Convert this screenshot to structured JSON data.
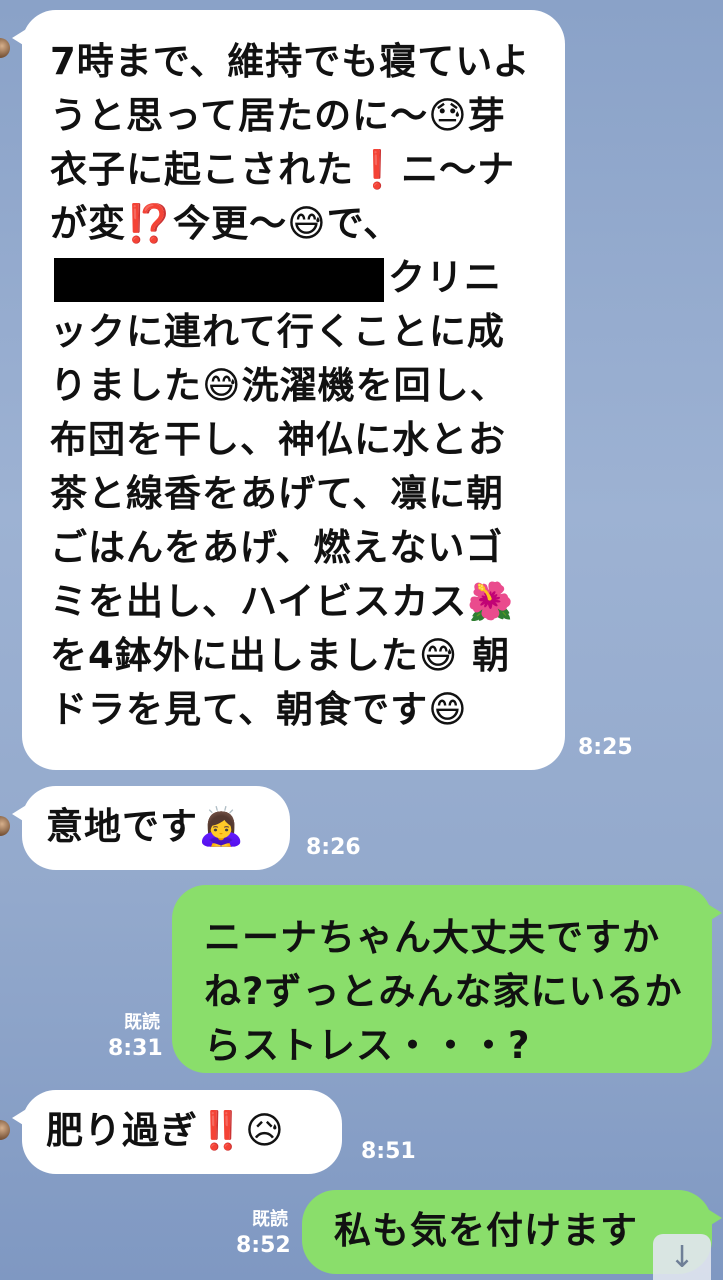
{
  "messages": [
    {
      "type": "received",
      "text_part1": "7時まで、維持でも寝ていようと思って居たのに～😓芽衣子に起こされた❗ニ～ナが変⁉️今更～😅で、",
      "text_part2": "クリニックに連れて行くことに成りました😅洗濯機を回し、布団を干し、神仏に水とお茶と線香をあげて、凛に朝ごはんをあげ、燃えないゴミを出し、ハイビスカス🌺を4鉢外に出しました😅 朝ドラを見て、朝食です😄",
      "time": "8:25"
    },
    {
      "type": "received",
      "text": "意地です🙇‍♀️",
      "time": "8:26"
    },
    {
      "type": "sent",
      "text": "ニーナちゃん大丈夫ですかね?ずっとみんな家にいるからストレス・・・?",
      "read": "既読",
      "time": "8:31"
    },
    {
      "type": "received",
      "text": "肥り過ぎ‼️😥",
      "time": "8:51"
    },
    {
      "type": "sent",
      "text": "私も気を付けます",
      "read": "既読",
      "time": "8:52"
    }
  ],
  "ui": {
    "scroll_to_bottom_icon": "down-arrow-icon"
  }
}
